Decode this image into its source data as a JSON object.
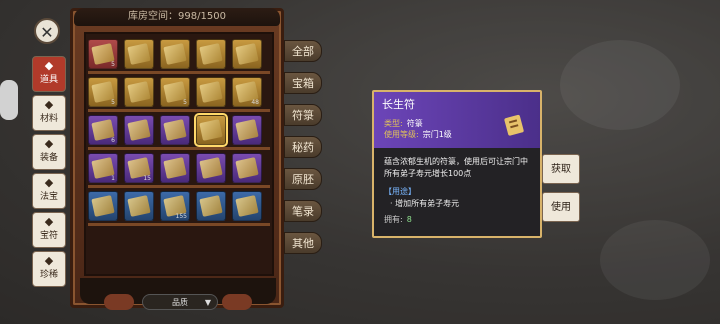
{
  "inventory": {
    "capacity_label": "库房空间：998/1500",
    "sort_label": "品质",
    "slots": [
      [
        {
          "r": "red",
          "n": "5"
        },
        {
          "r": "gold",
          "n": ""
        },
        {
          "r": "gold",
          "n": ""
        },
        {
          "r": "gold",
          "n": ""
        },
        {
          "r": "gold",
          "n": ""
        }
      ],
      [
        {
          "r": "gold",
          "n": "5"
        },
        {
          "r": "gold",
          "n": ""
        },
        {
          "r": "gold",
          "n": "5"
        },
        {
          "r": "gold",
          "n": ""
        },
        {
          "r": "gold",
          "n": "48"
        }
      ],
      [
        {
          "r": "purple",
          "n": "6"
        },
        {
          "r": "purple",
          "n": ""
        },
        {
          "r": "purple",
          "n": ""
        },
        {
          "r": "gold",
          "n": ""
        },
        {
          "r": "purple",
          "n": ""
        }
      ],
      [
        {
          "r": "purple",
          "n": "1"
        },
        {
          "r": "purple",
          "n": "15"
        },
        {
          "r": "purple",
          "n": ""
        },
        {
          "r": "purple",
          "n": ""
        },
        {
          "r": "purple",
          "n": ""
        }
      ],
      [
        {
          "r": "blue",
          "n": ""
        },
        {
          "r": "blue",
          "n": ""
        },
        {
          "r": "blue",
          "n": "155"
        },
        {
          "r": "blue",
          "n": ""
        },
        {
          "r": "blue",
          "n": ""
        }
      ]
    ]
  },
  "left_tabs": [
    {
      "label": "道具",
      "icon": "bag-icon",
      "active": true
    },
    {
      "label": "材料",
      "icon": "material-icon",
      "active": false
    },
    {
      "label": "装备",
      "icon": "equipment-icon",
      "active": false
    },
    {
      "label": "法宝",
      "icon": "treasure-icon",
      "active": false
    },
    {
      "label": "宝符",
      "icon": "talisman-icon",
      "active": false
    },
    {
      "label": "珍稀",
      "icon": "rare-icon",
      "active": false
    }
  ],
  "category_tabs": [
    "全部",
    "宝箱",
    "符箓",
    "秘药",
    "原胚",
    "笔录",
    "其他"
  ],
  "tooltip": {
    "title": "长生符",
    "type_key": "类型:",
    "type_val": "符箓",
    "level_key": "使用等级:",
    "level_val": "宗门1级",
    "description": "蕴含浓郁生机的符箓，使用后可让宗门中所有弟子寿元增长100点",
    "use_title": "【用途】",
    "use_item": "· 增加所有弟子寿元",
    "own_label": "拥有:",
    "own_value": "8"
  },
  "buttons": {
    "get": "获取",
    "use": "使用",
    "close": "✕"
  },
  "colors": {
    "panel_header": "#6c45b8",
    "panel_border": "#d8b36a",
    "active_tab": "#b13a2a"
  }
}
